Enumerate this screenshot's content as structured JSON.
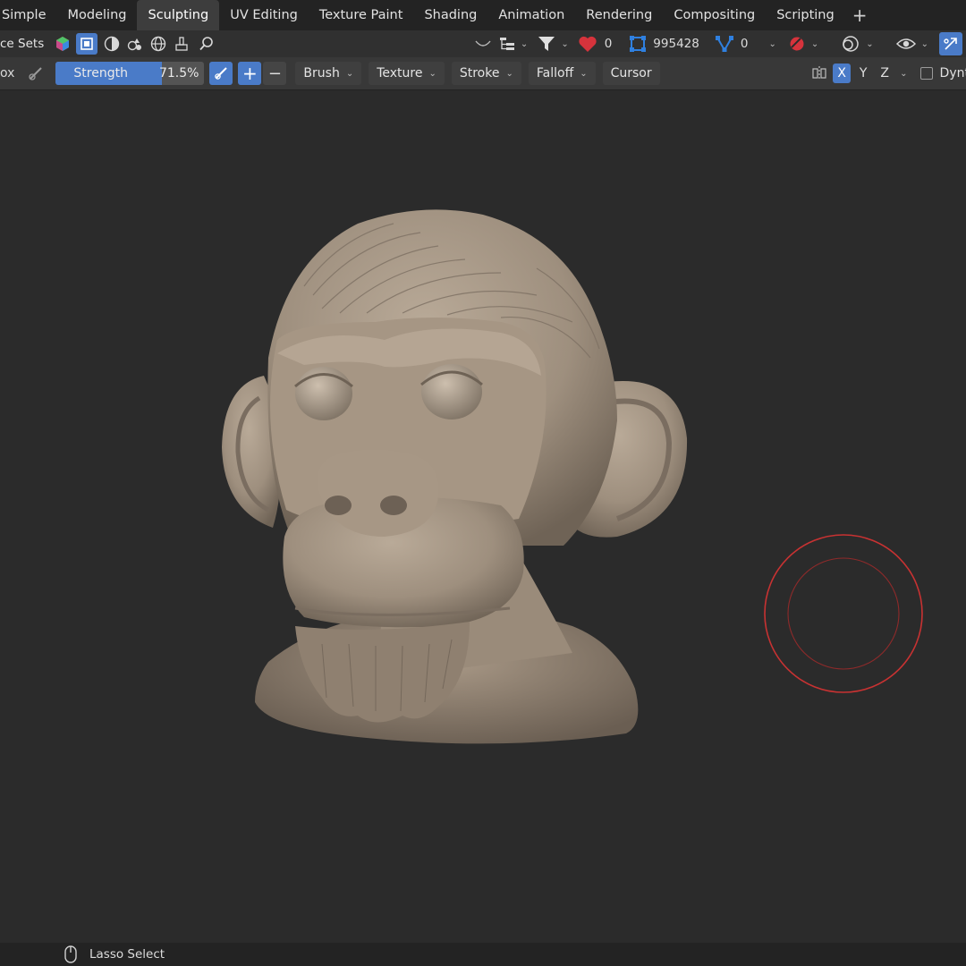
{
  "workspace_tabs": [
    {
      "label": "Simple",
      "active": false
    },
    {
      "label": "Modeling",
      "active": false
    },
    {
      "label": "Sculpting",
      "active": true
    },
    {
      "label": "UV Editing",
      "active": false
    },
    {
      "label": "Texture Paint",
      "active": false
    },
    {
      "label": "Shading",
      "active": false
    },
    {
      "label": "Animation",
      "active": false
    },
    {
      "label": "Rendering",
      "active": false
    },
    {
      "label": "Compositing",
      "active": false
    },
    {
      "label": "Scripting",
      "active": false
    }
  ],
  "add_tab_label": "+",
  "header": {
    "face_sets_label": "ce Sets",
    "stat_faces": "0",
    "stat_vertices": "995428",
    "stat_edges": "0",
    "accent_color": "#2f80e0",
    "heart_color": "#d6333c"
  },
  "toolbar": {
    "left_cut_label": "ox",
    "strength_label": "Strength",
    "strength_value_text": "71.5%",
    "strength_value": 0.715,
    "plus_label": "+",
    "minus_label": "−",
    "menus": [
      "Brush",
      "Texture",
      "Stroke",
      "Falloff",
      "Cursor"
    ],
    "axes": [
      {
        "label": "X",
        "active": true
      },
      {
        "label": "Y",
        "active": false
      },
      {
        "label": "Z",
        "active": false
      }
    ],
    "dyntopo_label": "Dyntopo",
    "slider_color": "#4a7bc8"
  },
  "viewport": {
    "background": "#2b2b2b",
    "brush_cursor_color": "#c83232"
  },
  "status": {
    "mouse_hint": "Lasso Select"
  }
}
